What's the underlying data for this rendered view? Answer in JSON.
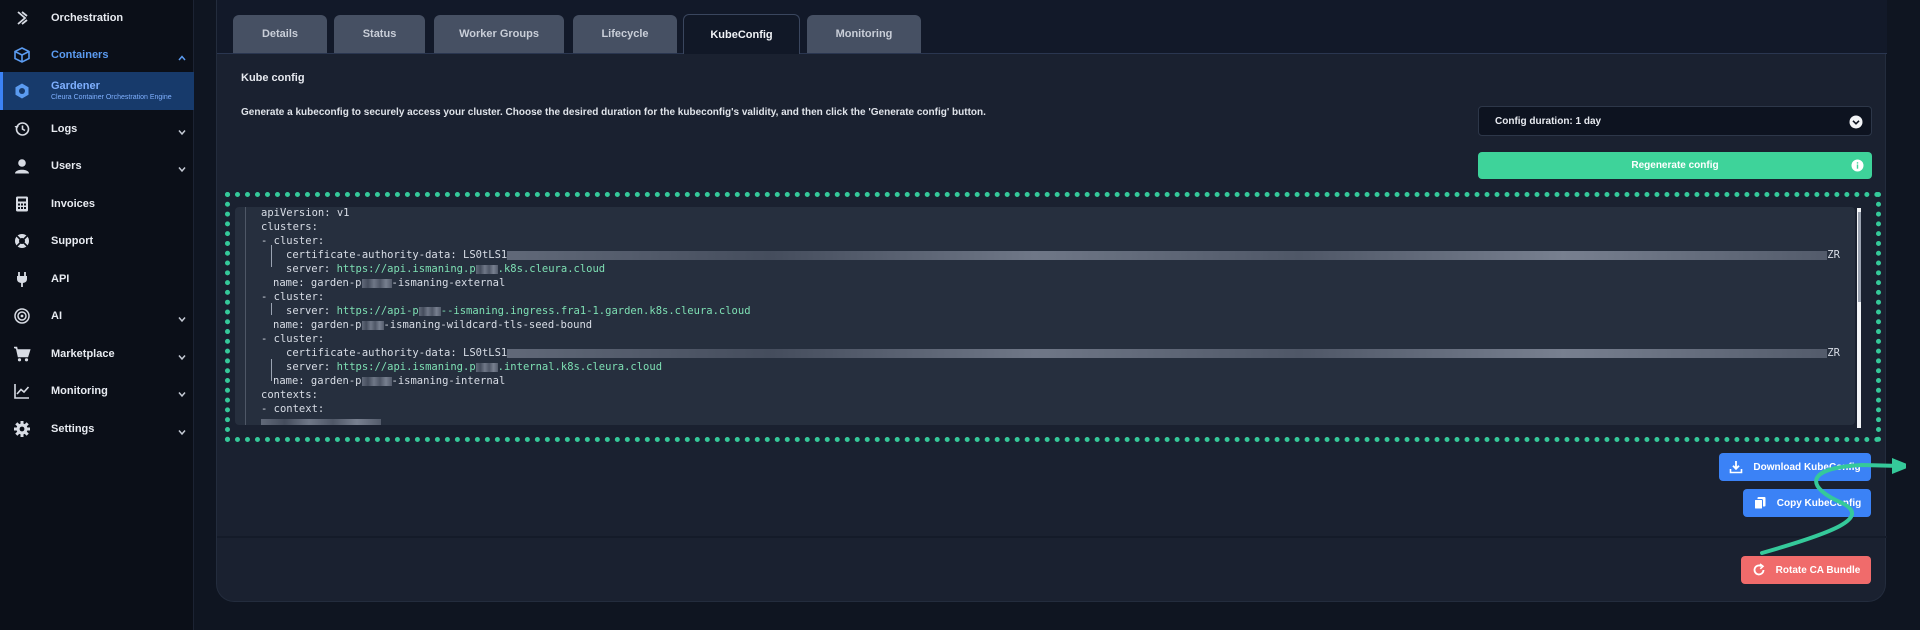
{
  "sidebar": {
    "items": [
      {
        "label": "Orchestration",
        "icon": "orchestration-icon"
      },
      {
        "label": "Containers",
        "icon": "cube-icon"
      },
      {
        "label": "Gardener",
        "sub": "Cleura Container Orchestration Engine",
        "icon": "gardener-icon"
      },
      {
        "label": "Logs",
        "icon": "history-icon"
      },
      {
        "label": "Users",
        "icon": "user-icon"
      },
      {
        "label": "Invoices",
        "icon": "calculator-icon"
      },
      {
        "label": "Support",
        "icon": "lifebuoy-icon"
      },
      {
        "label": "API",
        "icon": "plug-icon"
      },
      {
        "label": "AI",
        "icon": "ai-icon"
      },
      {
        "label": "Marketplace",
        "icon": "cart-icon"
      },
      {
        "label": "Monitoring",
        "icon": "chart-icon"
      },
      {
        "label": "Settings",
        "icon": "gear-icon"
      }
    ]
  },
  "tabs": [
    {
      "label": "Details"
    },
    {
      "label": "Status"
    },
    {
      "label": "Worker Groups"
    },
    {
      "label": "Lifecycle"
    },
    {
      "label": "KubeConfig"
    },
    {
      "label": "Monitoring"
    }
  ],
  "kubeconfig": {
    "title": "Kube config",
    "description": "Generate a kubeconfig to securely access your cluster. Choose the desired duration for the kubeconfig's validity, and then click the 'Generate config' button.",
    "duration_select": "Config duration: 1 day",
    "regenerate_label": "Regenerate config",
    "download_label": "Download KubeConfig",
    "copy_label": "Copy KubeConfig",
    "rotate_label": "Rotate CA Bundle"
  },
  "code": {
    "l1": "apiVersion: v1",
    "l2": "clusters:",
    "l3": "- cluster:",
    "l4a": "certificate-authority-data: LS0tLS1",
    "l4b": "ZR",
    "l5a": "server: ",
    "l5b": "https://api.ismaning.p",
    "l5c": ".k8s.cleura.cloud",
    "l6a": "name: garden-p",
    "l6b": "-ismaning-external",
    "l7": "- cluster:",
    "l8a": "server: ",
    "l8b": "https://api-p",
    "l8c": "--ismaning.ingress.fra1-1.garden.k8s.cleura.cloud",
    "l9a": "name: garden-p",
    "l9b": "-ismaning-wildcard-tls-seed-bound",
    "l10": "- cluster:",
    "l11a": "certificate-authority-data: LS0tLS1",
    "l11b": "ZR",
    "l12a": "server: ",
    "l12b": "https://api.ismaning.p",
    "l12c": ".internal.k8s.cleura.cloud",
    "l13a": "name: garden-p",
    "l13b": "-ismaning-internal",
    "l14": "contexts:",
    "l15": "- context:"
  },
  "colors": {
    "accent_green": "#3ed39a",
    "accent_blue": "#3b82f6",
    "danger": "#f06b6b",
    "highlight_frame": "#35c99a"
  }
}
